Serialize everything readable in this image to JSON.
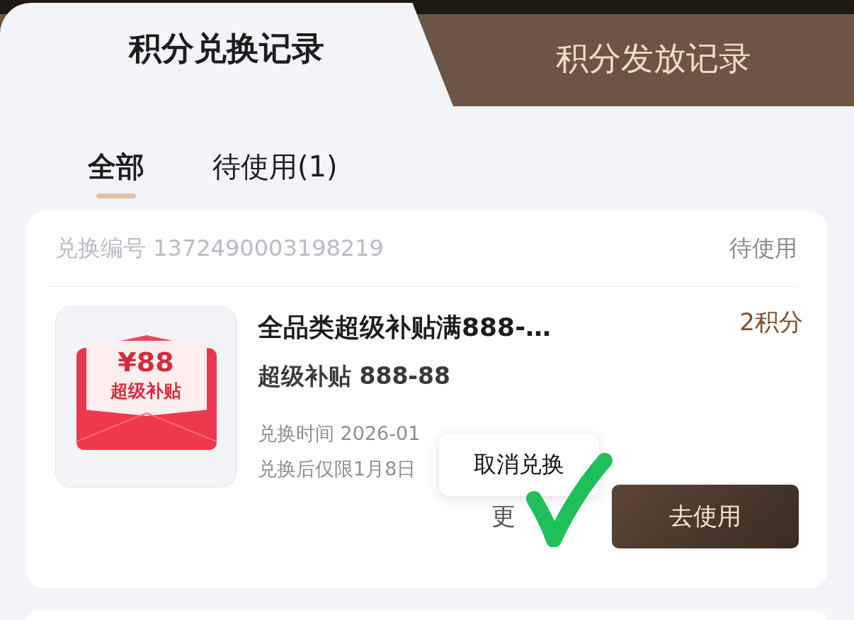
{
  "tabs": [
    {
      "label": "积分兑换记录",
      "selected": true
    },
    {
      "label": "积分发放记录",
      "selected": false
    }
  ],
  "filters": [
    {
      "label": "全部",
      "selected": true
    },
    {
      "label": "待使用(1)",
      "selected": false
    }
  ],
  "record": {
    "number": "兑换编号 1372490003198219",
    "status": "待使用",
    "image_amount": "¥88",
    "image_caption": "超级补贴",
    "title": "全品类超级补贴满888-…",
    "points": "2积分",
    "subtitle": "超级补贴 888-88",
    "time": "兑换时间 2026-01",
    "note": "兑换后仅限1月8日",
    "more": "更",
    "menu_item": "取消兑换",
    "use_button": "去使用"
  }
}
